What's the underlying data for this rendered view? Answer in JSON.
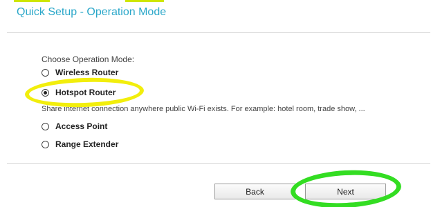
{
  "header": {
    "title": "Quick Setup - Operation Mode"
  },
  "form": {
    "prompt": "Choose Operation Mode:",
    "options": [
      {
        "label": "Wireless Router",
        "selected": false
      },
      {
        "label": "Hotspot Router",
        "selected": true
      },
      {
        "label": "Access Point",
        "selected": false
      },
      {
        "label": "Range Extender",
        "selected": false
      }
    ],
    "hotspot_description": "Share internet connection anywhere public Wi-Fi exists. For example: hotel room, trade show, ..."
  },
  "buttons": {
    "back_label": "Back",
    "next_label": "Next"
  },
  "colors": {
    "title": "#2aa7c9",
    "annotation_yellow": "#f2ee0c",
    "annotation_green": "#33dd22"
  }
}
